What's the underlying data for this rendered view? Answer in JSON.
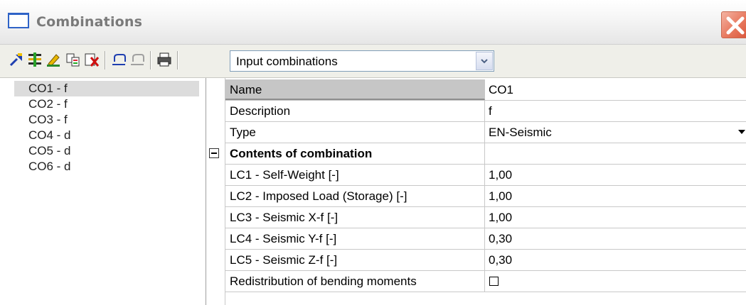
{
  "window": {
    "title": "Combinations"
  },
  "toolbar": {
    "icons": [
      "new-icon",
      "insert-row-icon",
      "edit-icon",
      "copy-icon",
      "delete-icon",
      "undo-icon",
      "redo-icon",
      "print-icon"
    ],
    "view_select": "Input combinations"
  },
  "combinations": [
    {
      "label": "CO1 - f"
    },
    {
      "label": "CO2 - f"
    },
    {
      "label": "CO3 - f"
    },
    {
      "label": "CO4 - d"
    },
    {
      "label": "CO5 - d"
    },
    {
      "label": "CO6 - d"
    }
  ],
  "properties": {
    "name": {
      "label": "Name",
      "value": "CO1"
    },
    "description": {
      "label": "Description",
      "value": "f"
    },
    "type": {
      "label": "Type",
      "value": "EN-Seismic"
    },
    "contents": {
      "label": "Contents of combination"
    },
    "load_cases": [
      {
        "label": "LC1 - Self-Weight [-]",
        "value": "1,00"
      },
      {
        "label": "LC2 - Imposed Load (Storage) [-]",
        "value": "1,00"
      },
      {
        "label": "LC3 - Seismic X-f [-]",
        "value": "1,00"
      },
      {
        "label": "LC4 - Seismic Y-f [-]",
        "value": "0,30"
      },
      {
        "label": "LC5 - Seismic Z-f [-]",
        "value": "0,30"
      }
    ],
    "redistribution": {
      "label": "Redistribution of bending moments",
      "checked": false
    }
  },
  "colors": {
    "title_icon": "#2f63c7",
    "close_button": "#e8795f",
    "header_cell": "#c6c6c6",
    "selected_item": "#dcdcdc"
  }
}
